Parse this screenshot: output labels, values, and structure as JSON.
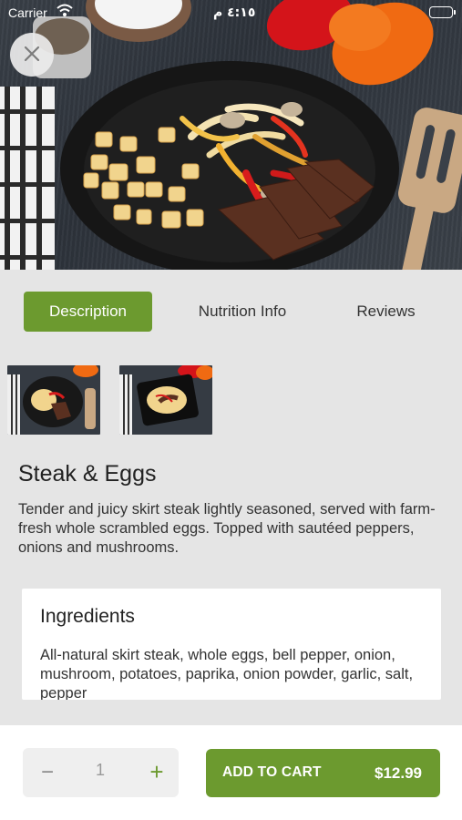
{
  "status_bar": {
    "carrier": "Carrier",
    "time": "٤:١٥ م"
  },
  "icons": {
    "close": "close-icon",
    "wifi": "wifi-icon",
    "battery": "battery-icon",
    "minus": "minus-icon",
    "plus": "plus-icon"
  },
  "tabs": [
    {
      "label": "Description",
      "active": true
    },
    {
      "label": "Nutrition Info",
      "active": false
    },
    {
      "label": "Reviews",
      "active": false
    }
  ],
  "product": {
    "title": "Steak & Eggs",
    "description": "Tender and juicy skirt steak lightly seasoned, served with farm-fresh whole scrambled eggs.  Topped with sautéed peppers, onions and mushrooms."
  },
  "ingredients": {
    "heading": "Ingredients",
    "text": "All-natural skirt steak, whole eggs, bell pepper, onion, mushroom, potatoes, paprika, onion powder, garlic, salt, pepper"
  },
  "cart": {
    "quantity": "1",
    "minus_symbol": "−",
    "plus_symbol": "+",
    "add_label": "ADD TO CART",
    "price": "$12.99"
  },
  "colors": {
    "accent": "#6c9a2f",
    "background": "#e5e5e5"
  }
}
